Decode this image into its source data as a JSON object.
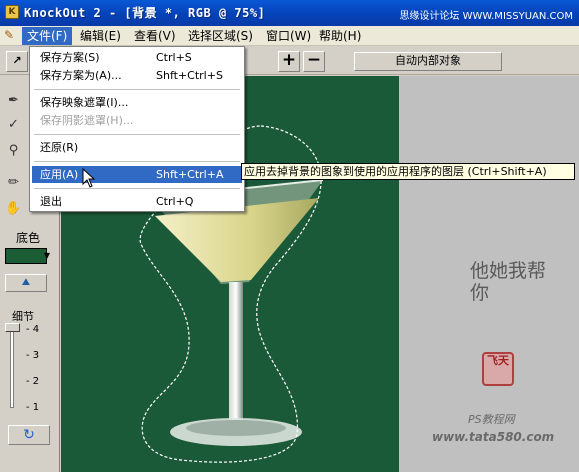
{
  "window": {
    "title": "KnockOut 2 - [背景 *, RGB @ 75%]",
    "watermark_top": "思缘设计论坛 WWW.MISSYUAN.COM"
  },
  "menubar": {
    "items": [
      {
        "label": "文件(F)"
      },
      {
        "label": "编辑(E)"
      },
      {
        "label": "查看(V)"
      },
      {
        "label": "选择区域(S)"
      },
      {
        "label": "窗口(W)"
      },
      {
        "label": "帮助(H)"
      }
    ]
  },
  "toolbar": {
    "plus_label": "+",
    "minus_label": "−",
    "auto_button_label": "自动内部对象"
  },
  "file_menu": {
    "items": [
      {
        "label": "保存方案(S)",
        "shortcut": "Ctrl+S"
      },
      {
        "label": "保存方案为(A)...",
        "shortcut": "Shft+Ctrl+S"
      },
      {
        "label": "保存映象遮罩(I)...",
        "shortcut": ""
      },
      {
        "label": "保存阴影遮罩(H)...",
        "shortcut": ""
      },
      {
        "label": "还原(R)",
        "shortcut": ""
      },
      {
        "label": "应用(A)",
        "shortcut": "Shft+Ctrl+A"
      },
      {
        "label": "退出",
        "shortcut": "Ctrl+Q"
      }
    ]
  },
  "tooltip": {
    "text": "应用去掉背景的图象到使用的应用程序的图层 (Ctrl+Shift+A)"
  },
  "side_panel": {
    "background_label": "底色",
    "background_color": "#1a5c33",
    "detail_label": "细节",
    "ticks": [
      "4",
      "3",
      "2",
      "1"
    ],
    "refresh_icon": "refresh-icon"
  },
  "watermark": {
    "signature": "他她我帮你",
    "seal": "飞天",
    "ps_text": "PS教程网",
    "url": "www.tata580.com"
  }
}
